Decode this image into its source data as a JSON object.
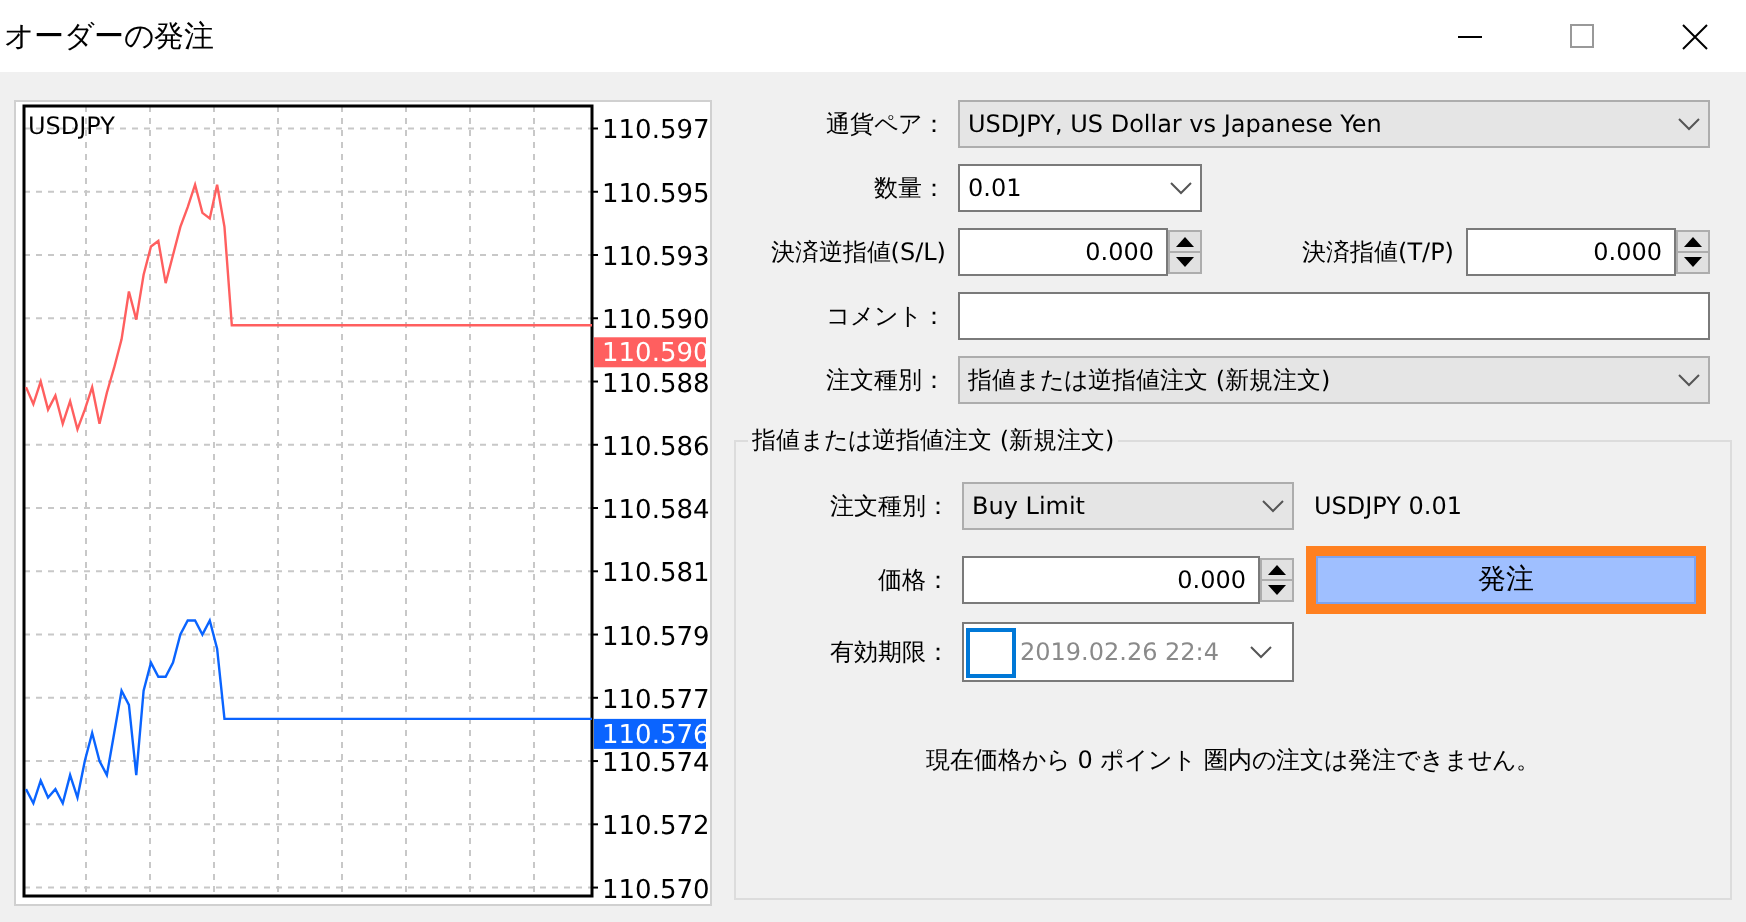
{
  "window": {
    "title": "オーダーの発注"
  },
  "chart": {
    "symbol": "USDJPY",
    "bid_tag": "110.590",
    "ask_tag": "110.576",
    "chart_data": {
      "type": "line",
      "categories": [
        null,
        null,
        null,
        null,
        null,
        null,
        null,
        null,
        null,
        null,
        null,
        null,
        null,
        null,
        null,
        null,
        null,
        null,
        null,
        null,
        null,
        null,
        null,
        null,
        null,
        null,
        null,
        null,
        null,
        null,
        null,
        null,
        null,
        null,
        null,
        null,
        null,
        null,
        null,
        null,
        null,
        null,
        null,
        null,
        null,
        null,
        null,
        null,
        null,
        null,
        null,
        null,
        null,
        null,
        null,
        null,
        null,
        null,
        null,
        null,
        null,
        null,
        null,
        null,
        null,
        null,
        null,
        null,
        null,
        null,
        null,
        null,
        null,
        null,
        null,
        null,
        null,
        null
      ],
      "ylim": [
        110.5697,
        110.5978
      ],
      "grid": true,
      "yticks": [
        {
          "value": 110.597,
          "label": "110.597"
        },
        {
          "value": 110.59475,
          "label": "110.595"
        },
        {
          "value": 110.5925,
          "label": "110.593"
        },
        {
          "value": 110.59025,
          "label": "110.590"
        },
        {
          "value": 110.588,
          "label": "110.588"
        },
        {
          "value": 110.58575,
          "label": "110.586"
        },
        {
          "value": 110.5835,
          "label": "110.584"
        },
        {
          "value": 110.58125,
          "label": "110.581"
        },
        {
          "value": 110.579,
          "label": "110.579"
        },
        {
          "value": 110.57675,
          "label": "110.577"
        },
        {
          "value": 110.5745,
          "label": "110.574"
        },
        {
          "value": 110.57225,
          "label": "110.572"
        },
        {
          "value": 110.57,
          "label": "110.570"
        }
      ],
      "series": [
        {
          "color": "#ff5f5f",
          "values": [
            110.5878,
            110.5872,
            110.588,
            110.587,
            110.5875,
            110.5865,
            110.5873,
            110.5863,
            110.587,
            110.5878,
            110.5865,
            110.5876,
            110.5885,
            110.5895,
            110.5912,
            110.5902,
            110.5918,
            110.5928,
            110.593,
            110.5915,
            110.5925,
            110.5935,
            110.5942,
            110.595,
            110.594,
            110.5938,
            110.595,
            110.5935,
            110.59,
            110.59,
            110.59,
            110.59,
            110.59,
            110.59,
            110.59,
            110.59,
            110.59,
            110.59,
            110.59,
            110.59,
            110.59,
            110.59,
            110.59,
            110.59,
            110.59,
            110.59,
            110.59,
            110.59,
            110.59,
            110.59,
            110.59,
            110.59,
            110.59,
            110.59,
            110.59,
            110.59,
            110.59,
            110.59,
            110.59,
            110.59,
            110.59,
            110.59,
            110.59,
            110.59,
            110.59,
            110.59,
            110.59,
            110.59,
            110.59,
            110.59,
            110.59,
            110.59,
            110.59,
            110.59,
            110.59,
            110.59,
            110.59,
            110.59
          ]
        },
        {
          "color": "#0a64ff",
          "values": [
            110.5735,
            110.573,
            110.5738,
            110.5732,
            110.5735,
            110.573,
            110.574,
            110.5732,
            110.5745,
            110.5755,
            110.5745,
            110.574,
            110.5755,
            110.577,
            110.5765,
            110.574,
            110.577,
            110.578,
            110.5775,
            110.5775,
            110.578,
            110.579,
            110.5795,
            110.5795,
            110.579,
            110.5795,
            110.5785,
            110.576,
            110.576,
            110.576,
            110.576,
            110.576,
            110.576,
            110.576,
            110.576,
            110.576,
            110.576,
            110.576,
            110.576,
            110.576,
            110.576,
            110.576,
            110.576,
            110.576,
            110.576,
            110.576,
            110.576,
            110.576,
            110.576,
            110.576,
            110.576,
            110.576,
            110.576,
            110.576,
            110.576,
            110.576,
            110.576,
            110.576,
            110.576,
            110.576,
            110.576,
            110.576,
            110.576,
            110.576,
            110.576,
            110.576,
            110.576,
            110.576,
            110.576,
            110.576,
            110.576,
            110.576,
            110.576,
            110.576,
            110.576,
            110.576,
            110.576,
            110.576
          ]
        }
      ]
    }
  },
  "form": {
    "currency_pair": {
      "label": "通貨ペア：",
      "value": "USDJPY, US Dollar vs Japanese Yen"
    },
    "volume": {
      "label": "数量：",
      "value": "0.01"
    },
    "stop_loss": {
      "label": "決済逆指値(S/L)",
      "value": "0.000"
    },
    "take_profit": {
      "label": "決済指値(T/P)",
      "value": "0.000"
    },
    "comment": {
      "label": "コメント："
    },
    "order_type": {
      "label": "注文種別：",
      "value": "指値または逆指値注文 (新規注文)"
    }
  },
  "pending_order": {
    "legend": "指値または逆指値注文 (新規注文)",
    "order_type": {
      "label": "注文種別：",
      "value": "Buy Limit"
    },
    "summary": "USDJPY 0.01",
    "price": {
      "label": "価格：",
      "value": "0.000"
    },
    "place_button": {
      "label": "発注",
      "highlighted": true
    },
    "expiration": {
      "label": "有効期限：",
      "checked": false,
      "value": "2019.02.26 22:4",
      "disabled": true
    },
    "note": "現在価格から 0 ポイント 圏内の注文は発注できません。"
  }
}
